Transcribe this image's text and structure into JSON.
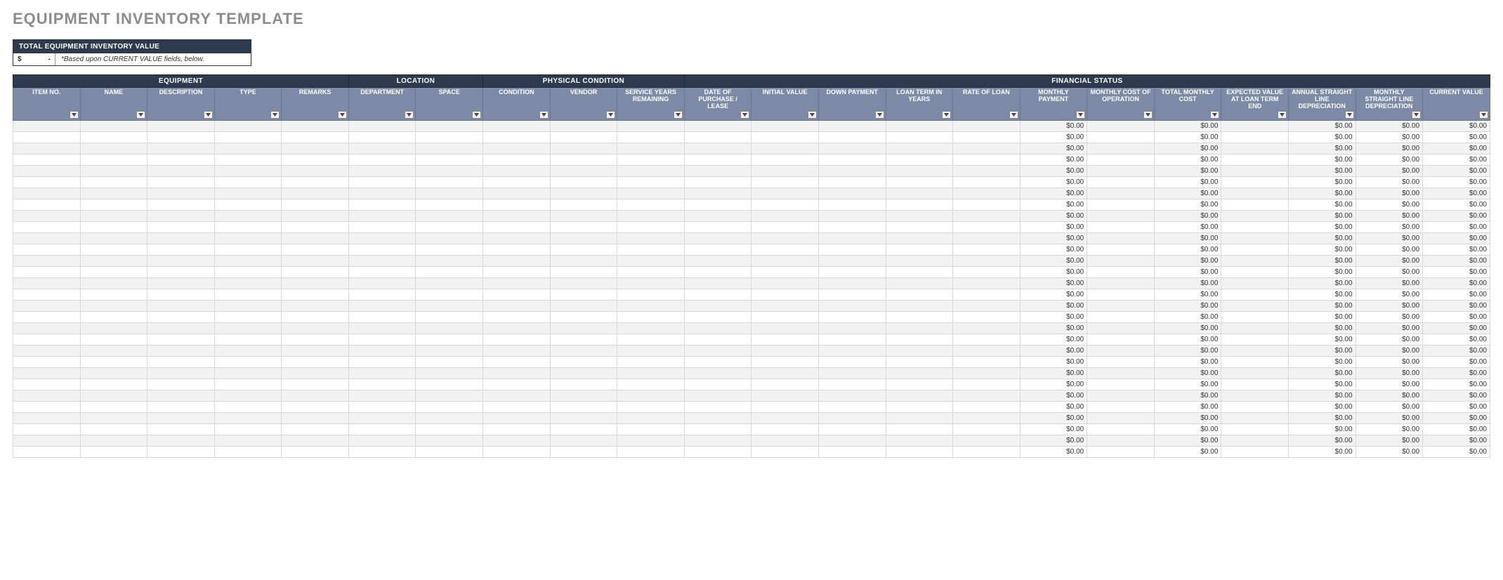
{
  "title": "EQUIPMENT INVENTORY TEMPLATE",
  "summary": {
    "header": "TOTAL EQUIPMENT INVENTORY VALUE",
    "value_prefix": "$",
    "value_suffix": "-",
    "note": "*Based upon CURRENT VALUE fields, below."
  },
  "groups": [
    {
      "label": "EQUIPMENT",
      "span": 5
    },
    {
      "label": "LOCATION",
      "span": 2
    },
    {
      "label": "PHYSICAL CONDITION",
      "span": 3
    },
    {
      "label": "FINANCIAL STATUS",
      "span": 12
    }
  ],
  "columns": [
    {
      "key": "item_no",
      "label": "ITEM NO.",
      "cls": "c-itemno",
      "calc": false
    },
    {
      "key": "name",
      "label": "NAME",
      "cls": "c-name",
      "calc": false
    },
    {
      "key": "description",
      "label": "DESCRIPTION",
      "cls": "c-desc",
      "calc": false
    },
    {
      "key": "type",
      "label": "TYPE",
      "cls": "c-type",
      "calc": false
    },
    {
      "key": "remarks",
      "label": "REMARKS",
      "cls": "c-remarks",
      "calc": false
    },
    {
      "key": "department",
      "label": "DEPARTMENT",
      "cls": "c-dept",
      "calc": false
    },
    {
      "key": "space",
      "label": "SPACE",
      "cls": "c-space",
      "calc": false
    },
    {
      "key": "condition",
      "label": "CONDITION",
      "cls": "c-cond",
      "calc": false
    },
    {
      "key": "vendor",
      "label": "VENDOR",
      "cls": "c-vendor",
      "calc": false
    },
    {
      "key": "service_years",
      "label": "SERVICE YEARS REMAINING",
      "cls": "c-service",
      "calc": false
    },
    {
      "key": "date_purchase",
      "label": "DATE OF PURCHASE / LEASE",
      "cls": "c-date",
      "calc": false
    },
    {
      "key": "initial_value",
      "label": "INITIAL VALUE",
      "cls": "c-initval",
      "calc": false
    },
    {
      "key": "down_payment",
      "label": "DOWN PAYMENT",
      "cls": "c-down",
      "calc": false
    },
    {
      "key": "loan_term",
      "label": "LOAN TERM IN YEARS",
      "cls": "c-loanterm",
      "calc": false
    },
    {
      "key": "rate_loan",
      "label": "RATE OF LOAN",
      "cls": "c-rate",
      "calc": false
    },
    {
      "key": "monthly_payment",
      "label": "MONTHLY PAYMENT",
      "cls": "c-mpay",
      "calc": true
    },
    {
      "key": "monthly_cost_op",
      "label": "MONTHLY COST OF OPERATION",
      "cls": "c-mcost",
      "calc": false
    },
    {
      "key": "total_monthly_cost",
      "label": "TOTAL MONTHLY COST",
      "cls": "c-tmcost",
      "calc": true
    },
    {
      "key": "expected_value_end",
      "label": "EXPECTED VALUE AT LOAN TERM END",
      "cls": "c-expval",
      "calc": false
    },
    {
      "key": "annual_sl_dep",
      "label": "ANNUAL STRAIGHT LINE DEPRECIATION",
      "cls": "c-asld",
      "calc": true
    },
    {
      "key": "monthly_sl_dep",
      "label": "MONTHLY STRAIGHT LINE DEPRECIATION",
      "cls": "c-msld",
      "calc": true
    },
    {
      "key": "current_value",
      "label": "CURRENT VALUE",
      "cls": "c-curval",
      "calc": true
    }
  ],
  "default_calc_value": "$0.00",
  "row_count": 30
}
